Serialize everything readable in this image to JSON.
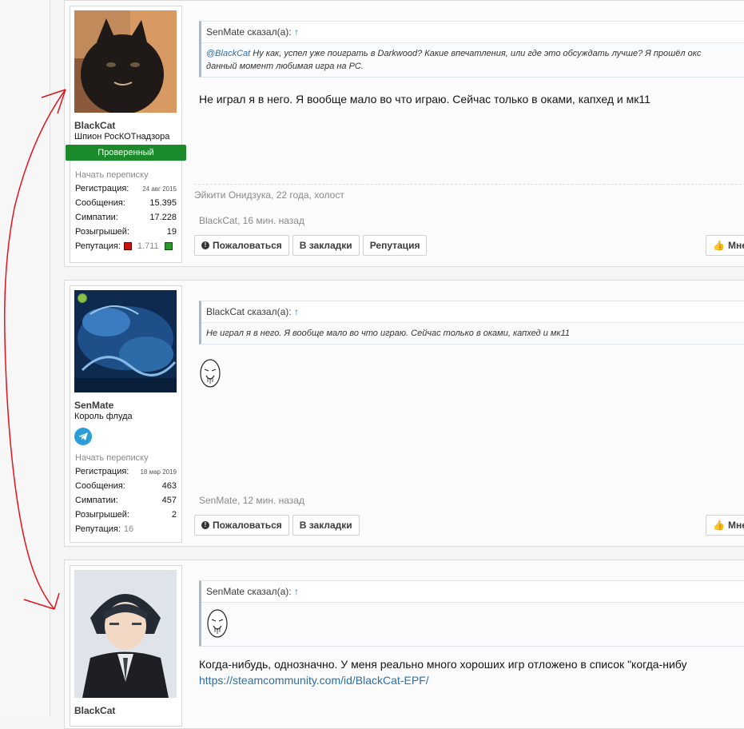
{
  "posts": [
    {
      "user": {
        "name": "BlackCat",
        "title": "Шпион РосКОТнадзора",
        "badge": "Проверенный",
        "pm": "Начать переписку",
        "stats": [
          {
            "label": "Регистрация:",
            "value": "24 авг 2015",
            "small": true
          },
          {
            "label": "Сообщения:",
            "value": "15.395"
          },
          {
            "label": "Симпатии:",
            "value": "17.228"
          },
          {
            "label": "Розыгрышей:",
            "value": "19"
          }
        ],
        "rep_label": "Репутация:",
        "rep_value": "1.711"
      },
      "quote": {
        "author": "SenMate сказал(а):",
        "arrow": "↑",
        "mention": "@BlackCat",
        "text": " Ну как, успел уже поиграть в Darkwood? Какие впечатления, или где это обсуждать лучше? Я прошёл окс",
        "text2": "данный момент любимая игра на PC."
      },
      "message": "Не играл я в него. Я вообще мало во что играю. Сейчас только в оками, капхед и мк11",
      "signature": "Эйкити Онидзука, 22 года, холост",
      "meta": "BlackCat, 16 мин. назад",
      "actions": [
        "Пожаловаться",
        "В закладки",
        "Репутация"
      ],
      "like": "Мне"
    },
    {
      "user": {
        "name": "SenMate",
        "title": "Король флуда",
        "pm": "Начать переписку",
        "stats": [
          {
            "label": "Регистрация:",
            "value": "18 мар 2019",
            "small": true
          },
          {
            "label": "Сообщения:",
            "value": "463"
          },
          {
            "label": "Симпатии:",
            "value": "457"
          },
          {
            "label": "Розыгрышей:",
            "value": "2"
          }
        ],
        "rep_label": "Репутация:",
        "rep_value": "16"
      },
      "quote": {
        "author": "BlackCat сказал(а):",
        "arrow": "↑",
        "text": "Не играл я в него. Я вообще мало во что играю. Сейчас только в оками, капхед и мк11"
      },
      "meta": "SenMate, 12 мин. назад",
      "actions": [
        "Пожаловаться",
        "В закладки"
      ],
      "like": "Мне"
    },
    {
      "user": {
        "name": "BlackCat"
      },
      "quote": {
        "author": "SenMate сказал(а):",
        "arrow": "↑"
      },
      "message": "Когда-нибудь, однозначно. У меня реально много хороших игр отложено в список \"когда-нибу",
      "link": "https://steamcommunity.com/id/BlackCat-EPF/"
    }
  ],
  "colors": {
    "accent": "#2a6fa8",
    "verified": "#1b8a2a",
    "annotation": "#e0141e"
  }
}
